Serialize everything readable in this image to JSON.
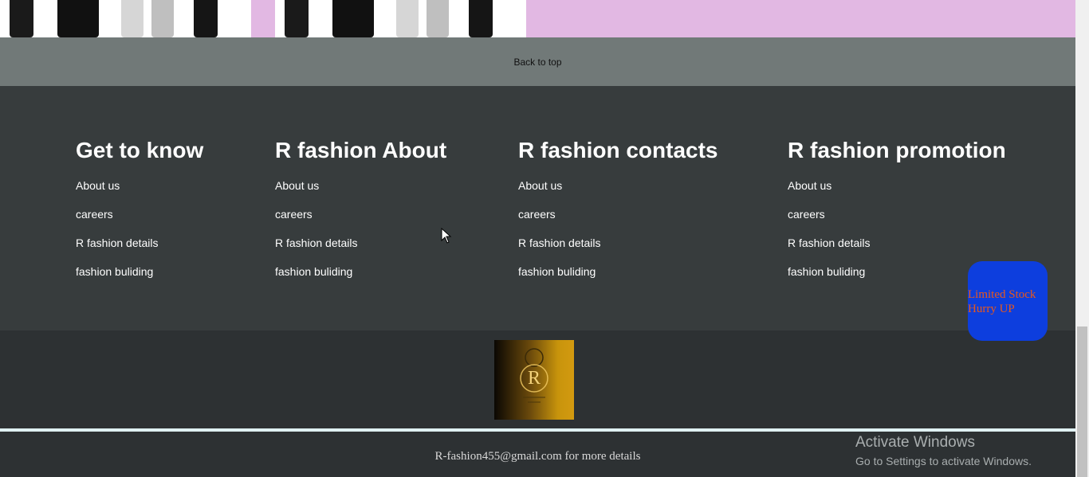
{
  "back_to_top": "Back to top",
  "footer_columns": [
    {
      "heading": "Get to know",
      "links": [
        "About us",
        "careers",
        "R fashion details",
        "fashion buliding"
      ]
    },
    {
      "heading": "R fashion About",
      "links": [
        "About us",
        "careers",
        "R fashion details",
        "fashion buliding"
      ]
    },
    {
      "heading": "R fashion contacts",
      "links": [
        "About us",
        "careers",
        "R fashion details",
        "fashion buliding"
      ]
    },
    {
      "heading": "R fashion promotion",
      "links": [
        "About us",
        "careers",
        "R fashion details",
        "fashion buliding"
      ]
    }
  ],
  "logo": {
    "letter": "R"
  },
  "contact_text": "R-fashion455@gmail.com for more details",
  "promo_badge": {
    "line1": "Limited Stock",
    "line2": "Hurry UP"
  },
  "watermark": {
    "title": "Activate Windows",
    "subtitle": "Go to Settings to activate Windows."
  },
  "colors": {
    "back_to_top_bg": "#717978",
    "footer_bg": "#373c3d",
    "bottom_bg": "#2d3133",
    "promo_bg": "#e2b8e3",
    "badge_bg": "#0d3ede",
    "badge_text": "#e8581c"
  }
}
